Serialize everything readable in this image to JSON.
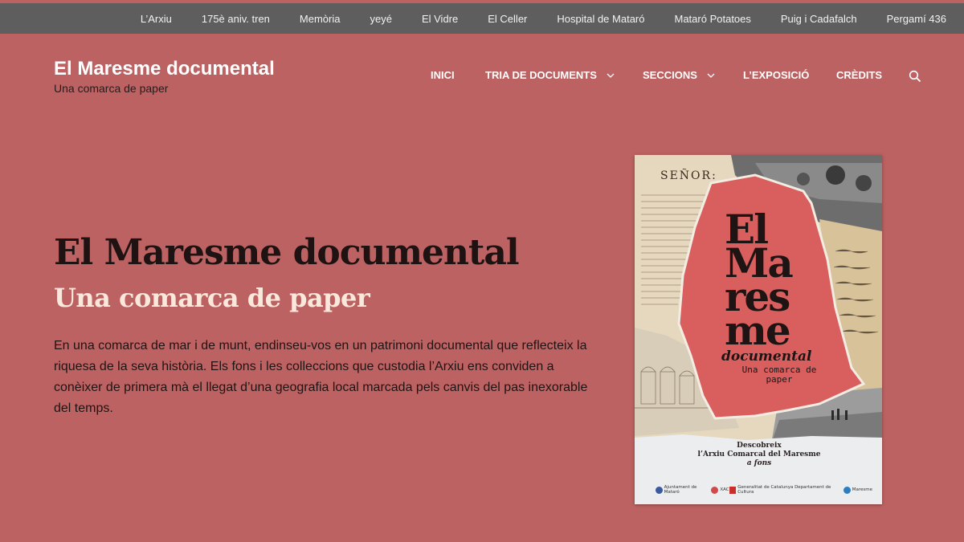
{
  "topbar": {
    "links": [
      "L’Arxiu",
      "175è aniv. tren",
      "Memòria",
      "yeyé",
      "El Vidre",
      "El Celler",
      "Hospital de Mataró",
      "Mataró Potatoes",
      "Puig i Cadafalch",
      "Pergamí 436"
    ]
  },
  "header": {
    "site_title": "El Maresme documental",
    "tagline": "Una comarca de paper"
  },
  "nav": {
    "items": [
      {
        "label": "INICI",
        "dropdown": false
      },
      {
        "label": "TRIA DE DOCUMENTS",
        "dropdown": true
      },
      {
        "label": "SECCIONS",
        "dropdown": true
      },
      {
        "label": "L’EXPOSICIÓ",
        "dropdown": false
      },
      {
        "label": "CRÈDITS",
        "dropdown": false
      }
    ],
    "search_icon": "search-icon"
  },
  "hero": {
    "title": "El Maresme documental",
    "subtitle": "Una comarca de paper",
    "text": "En una comarca de mar i de munt, endinseu-vos en un patrimoni documental que reflecteix la riquesa de la seva història. Els fons i les colleccions que custodia l’Arxiu ens conviden a conèixer de primera mà el llegat d’una geografia local marcada pels canvis del pas inexorable del temps."
  },
  "poster": {
    "signor": "SEÑOR:",
    "title_lines": [
      "El",
      "Ma",
      "res",
      "me"
    ],
    "documental": "documental",
    "comarca": "Una comarca de paper",
    "desc_line1": "Descobreix",
    "desc_line2": "l’Arxiu Comarcal del Maresme",
    "desc_line3": "a fons",
    "logos": [
      "Ajuntament de Mataró",
      "XAC",
      "Generalitat de Catalunya Departament de Cultura",
      "Maresme"
    ]
  },
  "colors": {
    "background": "#bd6262",
    "topbar": "#5e5e5e",
    "poster_red": "#d95f5f",
    "title_dark": "#1f1212",
    "subtitle_cream": "#fbe8dc"
  }
}
